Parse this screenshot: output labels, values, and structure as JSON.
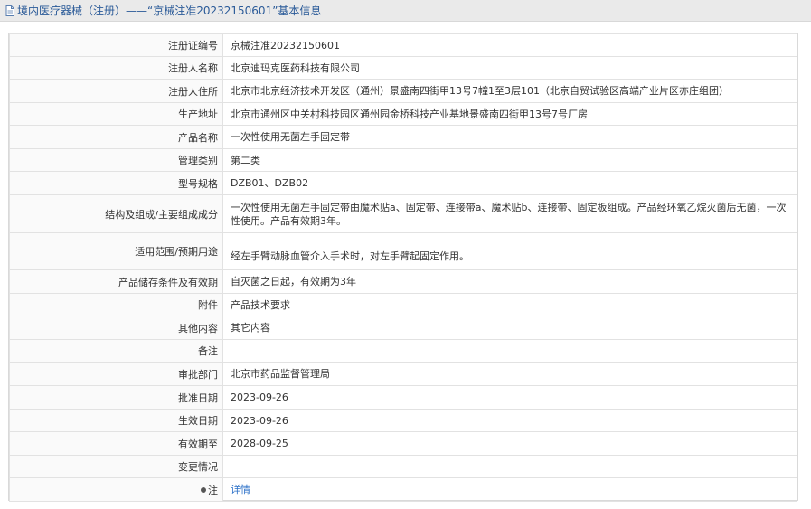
{
  "header": {
    "title": "境内医疗器械（注册）——“京械注准20232150601”基本信息"
  },
  "rows": [
    {
      "label": "注册证编号",
      "value": "京械注准20232150601"
    },
    {
      "label": "注册人名称",
      "value": "北京迪玛克医药科技有限公司"
    },
    {
      "label": "注册人住所",
      "value": "北京市北京经济技术开发区（通州）景盛南四街甲13号7幢1至3层101（北京自贸试验区高端产业片区亦庄组团）"
    },
    {
      "label": "生产地址",
      "value": "北京市通州区中关村科技园区通州园金桥科技产业基地景盛南四街甲13号7号厂房"
    },
    {
      "label": "产品名称",
      "value": "一次性使用无菌左手固定带"
    },
    {
      "label": "管理类别",
      "value": "第二类"
    },
    {
      "label": "型号规格",
      "value": "DZB01、DZB02"
    },
    {
      "label": "结构及组成/主要组成成分",
      "value": "一次性使用无菌左手固定带由魔术贴a、固定带、连接带a、魔术贴b、连接带、固定板组成。产品经环氧乙烷灭菌后无菌，一次性使用。产品有效期3年。"
    },
    {
      "label": "适用范围/预期用途",
      "value": "经左手臂动脉血管介入手术时，对左手臂起固定作用。"
    },
    {
      "label": "产品储存条件及有效期",
      "value": "自灭菌之日起，有效期为3年"
    },
    {
      "label": "附件",
      "value": "产品技术要求"
    },
    {
      "label": "其他内容",
      "value": "其它内容"
    },
    {
      "label": "备注",
      "value": ""
    },
    {
      "label": "审批部门",
      "value": "北京市药品监督管理局"
    },
    {
      "label": "批准日期",
      "value": "2023-09-26"
    },
    {
      "label": "生效日期",
      "value": "2023-09-26"
    },
    {
      "label": "有效期至",
      "value": "2028-09-25"
    },
    {
      "label": "变更情况",
      "value": ""
    },
    {
      "label": "注",
      "value": "详情"
    }
  ]
}
